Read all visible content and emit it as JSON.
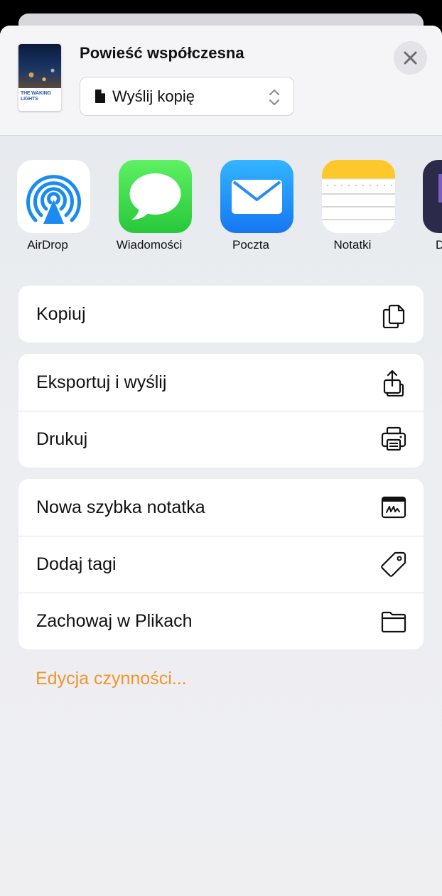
{
  "header": {
    "title": "Powieść współczesna",
    "cover_title": "THE WAKING LIGHTS",
    "picker_label": "Wyślij kopię",
    "close_icon": "close-icon"
  },
  "apps": [
    {
      "label": "AirDrop",
      "icon": "airdrop-icon"
    },
    {
      "label": "Wiadomości",
      "icon": "messages-icon"
    },
    {
      "label": "Poczta",
      "icon": "mail-icon"
    },
    {
      "label": "Notatki",
      "icon": "notes-icon"
    },
    {
      "label": "D",
      "icon": "app-icon"
    }
  ],
  "actions": {
    "group1": [
      {
        "label": "Kopiuj",
        "icon": "copy-icon"
      }
    ],
    "group2": [
      {
        "label": "Eksportuj i wyślij",
        "icon": "share-icon"
      },
      {
        "label": "Drukuj",
        "icon": "printer-icon"
      }
    ],
    "group3": [
      {
        "label": "Nowa szybka notatka",
        "icon": "quick-note-icon"
      },
      {
        "label": "Dodaj tagi",
        "icon": "tag-icon"
      },
      {
        "label": "Zachowaj w Plikach",
        "icon": "folder-icon"
      }
    ]
  },
  "edit_actions_label": "Edycja czynności...",
  "colors": {
    "accent": "#f0952a",
    "sheet_background": "#f2f2f7"
  }
}
